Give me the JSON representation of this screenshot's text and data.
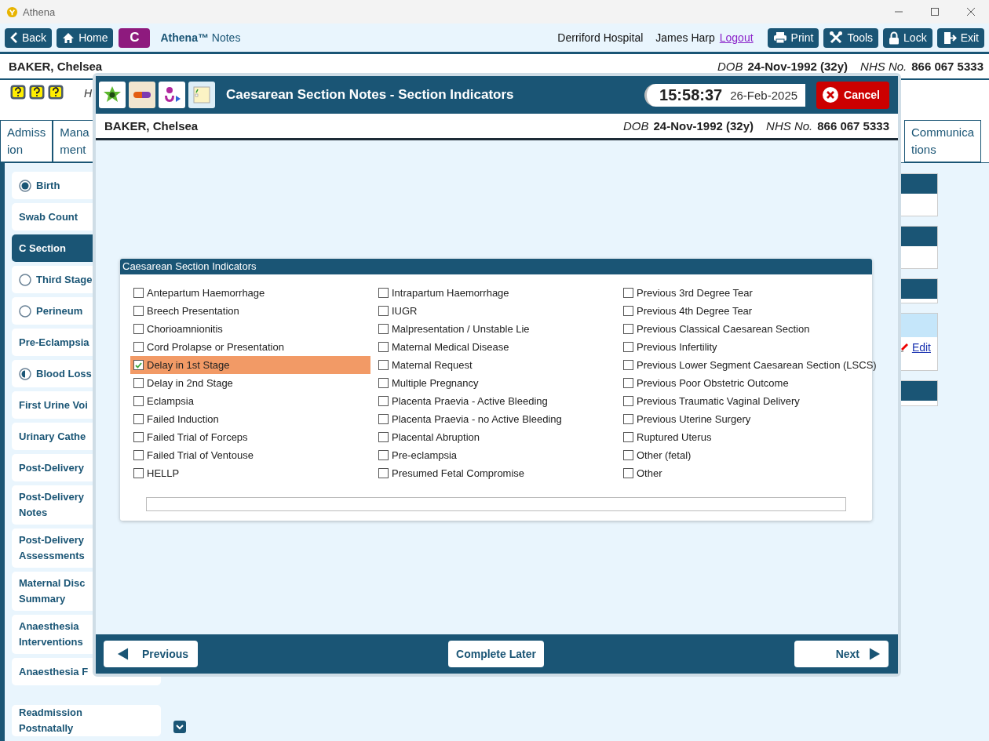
{
  "window": {
    "title": "Athena"
  },
  "toolbar": {
    "nav_buttons": [
      {
        "label": "Back",
        "kind": "back"
      },
      {
        "label": "Home",
        "kind": "home"
      }
    ],
    "app_badge": "C",
    "app_title": "**Athena™** Notes",
    "location": "Derriford Hospital",
    "user": "James Harp",
    "logout_link": "Logout",
    "action_buttons": [
      {
        "label": "Print",
        "kind": "print"
      },
      {
        "label": "Tools",
        "kind": "tools"
      },
      {
        "label": "Lock",
        "kind": "lock"
      },
      {
        "label": "Exit",
        "kind": "exit"
      }
    ]
  },
  "patient": {
    "name": "BAKER, Chelsea",
    "dob_label": "DOB",
    "dob": "24-Nov-1992 (32y)",
    "nhs_label": "NHS No.",
    "nhs": "866 067 5333"
  },
  "info_text": "H",
  "tabs": [
    {
      "lines": [
        "Admiss",
        "ion"
      ],
      "selected": false
    },
    {
      "lines": [
        "Mana",
        "ment"
      ],
      "selected": false
    },
    {
      "lines": [
        "Communica",
        "tions"
      ],
      "selected": false
    }
  ],
  "sidebar": {
    "items": [
      {
        "label": "Birth",
        "kind": "full",
        "selected": false
      },
      {
        "label": "Swab Count",
        "kind": "plain",
        "selected": false
      },
      {
        "label": "C Section",
        "kind": "plain",
        "selected": true
      },
      {
        "label": "Third Stage",
        "kind": "empty",
        "selected": false
      },
      {
        "label": "Perineum",
        "kind": "empty",
        "selected": false
      },
      {
        "label": "Pre-Eclampsia",
        "kind": "plain",
        "selected": false
      },
      {
        "label": "Blood Loss",
        "kind": "half",
        "selected": false
      },
      {
        "label": "First Urine Voi",
        "kind": "plain",
        "selected": false
      },
      {
        "label": "Urinary Cathe",
        "kind": "plain",
        "selected": false
      },
      {
        "label": "Post-Delivery",
        "kind": "plain",
        "selected": false
      },
      {
        "label": "Post-Delivery Notes",
        "kind": "plain",
        "selected": false
      },
      {
        "label": "Post-Delivery Assessments",
        "kind": "plain",
        "selected": false
      },
      {
        "label": "Maternal Disc Summary",
        "kind": "plain",
        "selected": false
      },
      {
        "label": "Anaesthesia Interventions",
        "kind": "plain",
        "selected": false
      },
      {
        "label": "Anaesthesia F",
        "kind": "plain",
        "selected": false
      },
      {
        "label": "Readmission Postnatally",
        "kind": "plain",
        "selected": false
      }
    ]
  },
  "side_panels": {
    "edit_link": "Edit"
  },
  "dialog": {
    "title": "Caesarean Section Notes - Section Indicators",
    "time": "15:58:37",
    "date": "26-Feb-2025",
    "cancel_button": "Cancel",
    "patient": {
      "name": "BAKER, Chelsea",
      "dob_label": "DOB",
      "dob": "24-Nov-1992 (32y)",
      "nhs_label": "NHS No.",
      "nhs": "866 067 5333"
    },
    "indicators": {
      "title": "Caesarean Section Indicators",
      "columns": [
        [
          {
            "label": "Antepartum Haemorrhage",
            "checked": false
          },
          {
            "label": "Breech Presentation",
            "checked": false
          },
          {
            "label": "Chorioamnionitis",
            "checked": false
          },
          {
            "label": "Cord Prolapse or Presentation",
            "checked": false
          },
          {
            "label": "Delay in 1st Stage",
            "checked": true
          },
          {
            "label": "Delay in 2nd Stage",
            "checked": false
          },
          {
            "label": "Eclampsia",
            "checked": false
          },
          {
            "label": "Failed Induction",
            "checked": false
          },
          {
            "label": "Failed Trial of Forceps",
            "checked": false
          },
          {
            "label": "Failed Trial of Ventouse",
            "checked": false
          },
          {
            "label": "HELLP",
            "checked": false
          }
        ],
        [
          {
            "label": "Intrapartum Haemorrhage",
            "checked": false
          },
          {
            "label": "IUGR",
            "checked": false
          },
          {
            "label": "Malpresentation / Unstable Lie",
            "checked": false
          },
          {
            "label": "Maternal Medical Disease",
            "checked": false
          },
          {
            "label": "Maternal Request",
            "checked": false
          },
          {
            "label": "Multiple Pregnancy",
            "checked": false
          },
          {
            "label": "Placenta Praevia - Active Bleeding",
            "checked": false
          },
          {
            "label": "Placenta Praevia - no Active Bleeding",
            "checked": false
          },
          {
            "label": "Placental Abruption",
            "checked": false
          },
          {
            "label": "Pre-eclampsia",
            "checked": false
          },
          {
            "label": "Presumed Fetal Compromise",
            "checked": false
          }
        ],
        [
          {
            "label": "Previous 3rd Degree Tear",
            "checked": false
          },
          {
            "label": "Previous 4th Degree Tear",
            "checked": false
          },
          {
            "label": "Previous Classical Caesarean Section",
            "checked": false
          },
          {
            "label": "Previous Infertility",
            "checked": false
          },
          {
            "label": "Previous Lower Segment Caesarean Section (LSCS)",
            "checked": false
          },
          {
            "label": "Previous Poor Obstetric Outcome",
            "checked": false
          },
          {
            "label": "Previous Traumatic Vaginal Delivery",
            "checked": false
          },
          {
            "label": "Previous Uterine Surgery",
            "checked": false
          },
          {
            "label": "Ruptured Uterus",
            "checked": false
          },
          {
            "label": "Other (fetal)",
            "checked": false
          },
          {
            "label": "Other",
            "checked": false
          }
        ]
      ]
    },
    "footer_buttons": [
      {
        "label": "Previous",
        "kind": "previous"
      },
      {
        "label": "Complete Later",
        "kind": "plain"
      },
      {
        "label": "Next",
        "kind": "next"
      }
    ]
  }
}
